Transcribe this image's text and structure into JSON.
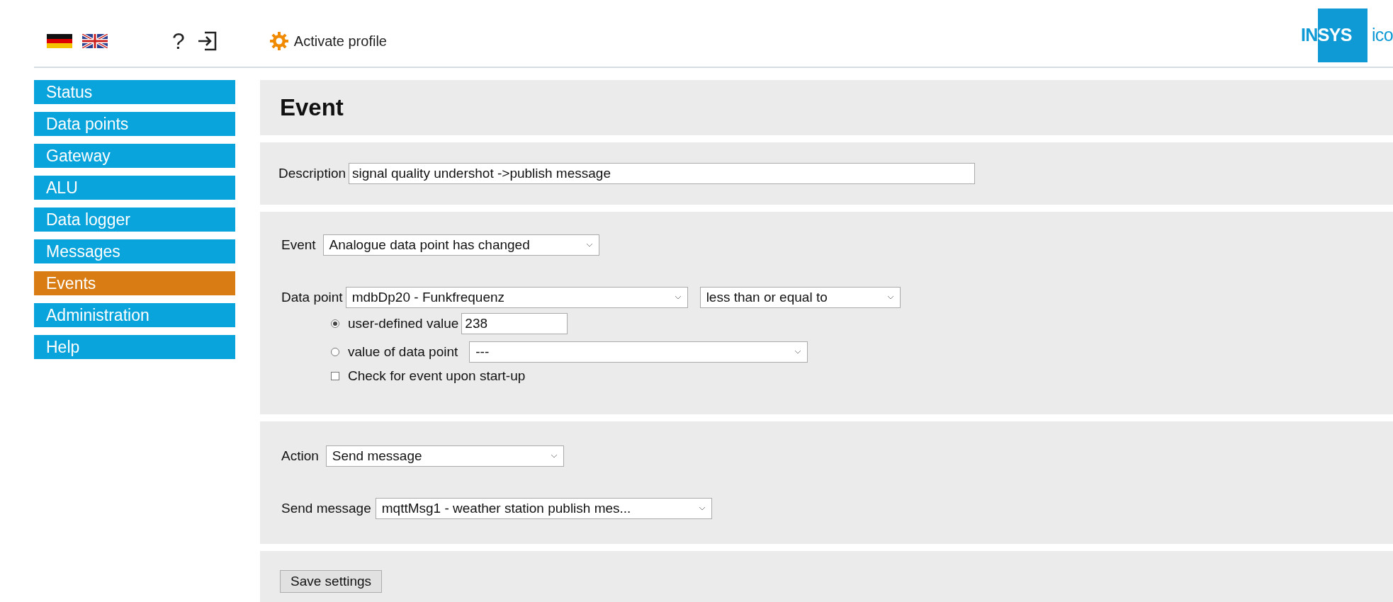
{
  "header": {
    "languages": [
      {
        "kind": "german"
      },
      {
        "kind": "british"
      }
    ],
    "help": "?",
    "activate_profile": "Activate profile",
    "logo": {
      "lead": "IN",
      "boxed": "SYS",
      "tail": "ico"
    }
  },
  "sidebar": {
    "items": [
      {
        "label": "Status",
        "selected": false
      },
      {
        "label": "Data points",
        "selected": false
      },
      {
        "label": "Gateway",
        "selected": false
      },
      {
        "label": "ALU",
        "selected": false
      },
      {
        "label": "Data logger",
        "selected": false
      },
      {
        "label": "Messages",
        "selected": false
      },
      {
        "label": "Events",
        "selected": true
      },
      {
        "label": "Administration",
        "selected": false
      },
      {
        "label": "Help",
        "selected": false
      }
    ]
  },
  "title": "Event",
  "description": {
    "label": "Description",
    "value": "signal quality undershot ->publish message"
  },
  "event": {
    "label": "Event",
    "value": "Analogue data point has changed"
  },
  "data_point": {
    "label": "Data point",
    "value": "mdbDp20 - Funkfrequenz",
    "operator": "less than or equal to"
  },
  "comparison": [
    {
      "kind": "input",
      "label": "user-defined value",
      "selected": true,
      "value": "238"
    },
    {
      "kind": "select",
      "label": "value of data point",
      "selected": false,
      "value": "---"
    }
  ],
  "startup_check": {
    "label": "Check for event upon start-up",
    "checked": false
  },
  "action": {
    "label": "Action",
    "value": "Send message"
  },
  "send_message": {
    "label": "Send message",
    "value": "mqttMsg1 - weather station publish mes..."
  },
  "save_button": "Save settings"
}
